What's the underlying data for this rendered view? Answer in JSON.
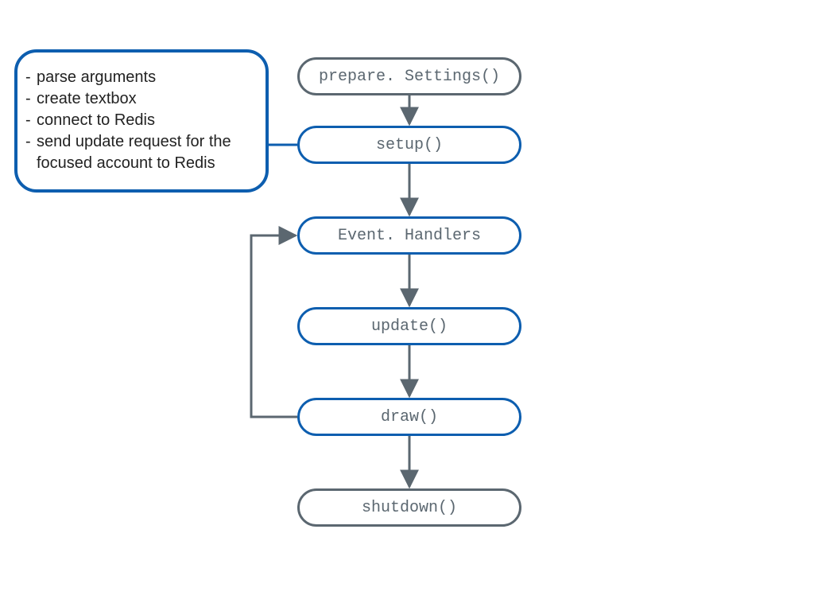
{
  "description": {
    "items": [
      "parse arguments",
      "create textbox",
      "connect to Redis",
      "send update request for the focused account to Redis"
    ]
  },
  "nodes": {
    "prepareSettings": "prepare. Settings()",
    "setup": "setup()",
    "eventHandlers": "Event. Handlers",
    "update": "update()",
    "draw": "draw()",
    "shutdown": "shutdown()"
  },
  "chart_data": {
    "type": "flowchart",
    "nodes": [
      {
        "id": "prepareSettings",
        "label": "prepare. Settings()",
        "style": "gray"
      },
      {
        "id": "setup",
        "label": "setup()",
        "style": "blue"
      },
      {
        "id": "eventHandlers",
        "label": "Event. Handlers",
        "style": "blue"
      },
      {
        "id": "update",
        "label": "update()",
        "style": "blue"
      },
      {
        "id": "draw",
        "label": "draw()",
        "style": "blue"
      },
      {
        "id": "shutdown",
        "label": "shutdown()",
        "style": "gray"
      }
    ],
    "edges": [
      {
        "from": "prepareSettings",
        "to": "setup"
      },
      {
        "from": "setup",
        "to": "eventHandlers"
      },
      {
        "from": "eventHandlers",
        "to": "update"
      },
      {
        "from": "update",
        "to": "draw"
      },
      {
        "from": "draw",
        "to": "shutdown"
      },
      {
        "from": "draw",
        "to": "eventHandlers",
        "kind": "loop-back"
      }
    ],
    "annotations": [
      {
        "attached_to": "setup",
        "bullets": [
          "parse arguments",
          "create textbox",
          "connect to Redis",
          "send update request for the focused account to Redis"
        ]
      }
    ]
  }
}
